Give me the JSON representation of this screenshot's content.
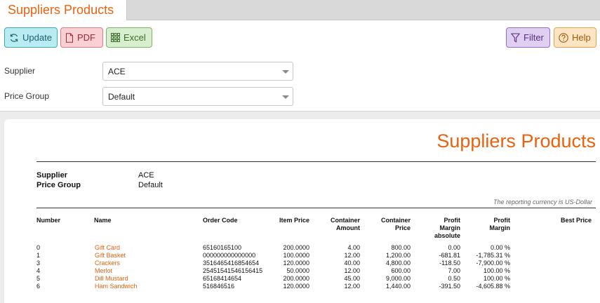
{
  "tab": {
    "title": "Suppliers Products"
  },
  "toolbar": {
    "update_label": "Update",
    "pdf_label": "PDF",
    "excel_label": "Excel",
    "filter_label": "Filter",
    "help_label": "Help"
  },
  "form": {
    "supplier_label": "Supplier",
    "supplier_value": "ACE",
    "price_group_label": "Price Group",
    "price_group_value": "Default"
  },
  "report": {
    "title": "Suppliers Products",
    "supplier_label": "Supplier",
    "supplier_value": "ACE",
    "price_group_label": "Price Group",
    "price_group_value": "Default",
    "currency_note": "The reporting currency is US-Dollar",
    "columns": {
      "number": "Number",
      "name": "Name",
      "order_code": "Order Code",
      "item_price": "Item Price",
      "container_amount": "Container Amount",
      "container_price": "Container Price",
      "profit_margin_absolute": "Profit Margin absolute",
      "profit_margin": "Profit Margin",
      "best_price": "Best Price"
    },
    "rows": [
      {
        "number": "0",
        "name": "Gift Card",
        "order_code": "65160165100",
        "item_price": "200.0000",
        "container_amount": "4.00",
        "container_price": "800.00",
        "profit_margin_absolute": "0.00",
        "profit_margin": "0.00 %"
      },
      {
        "number": "1",
        "name": "Gift Basket",
        "order_code": "000000000000000",
        "item_price": "100.0000",
        "container_amount": "12.00",
        "container_price": "1,200.00",
        "profit_margin_absolute": "-681.81",
        "profit_margin": "-1,785.31 %"
      },
      {
        "number": "3",
        "name": "Crackers",
        "order_code": "3516465416854654",
        "item_price": "120.0000",
        "container_amount": "40.00",
        "container_price": "4,800.00",
        "profit_margin_absolute": "-118.50",
        "profit_margin": "-7,900.00 %"
      },
      {
        "number": "4",
        "name": "Merlot",
        "order_code": "25451541546156415",
        "item_price": "50.0000",
        "container_amount": "12.00",
        "container_price": "600.00",
        "profit_margin_absolute": "7.00",
        "profit_margin": "100.00 %"
      },
      {
        "number": "5",
        "name": "Dill Mustard",
        "order_code": "65168414654",
        "item_price": "200.0000",
        "container_amount": "45.00",
        "container_price": "9,000.00",
        "profit_margin_absolute": "0.50",
        "profit_margin": "100.00 %"
      },
      {
        "number": "6",
        "name": "Ham Sandwich",
        "order_code": "516846516",
        "item_price": "120.0000",
        "container_amount": "12.00",
        "container_price": "1,440.00",
        "profit_margin_absolute": "-391.50",
        "profit_margin": "-4,605.88 %"
      }
    ]
  }
}
